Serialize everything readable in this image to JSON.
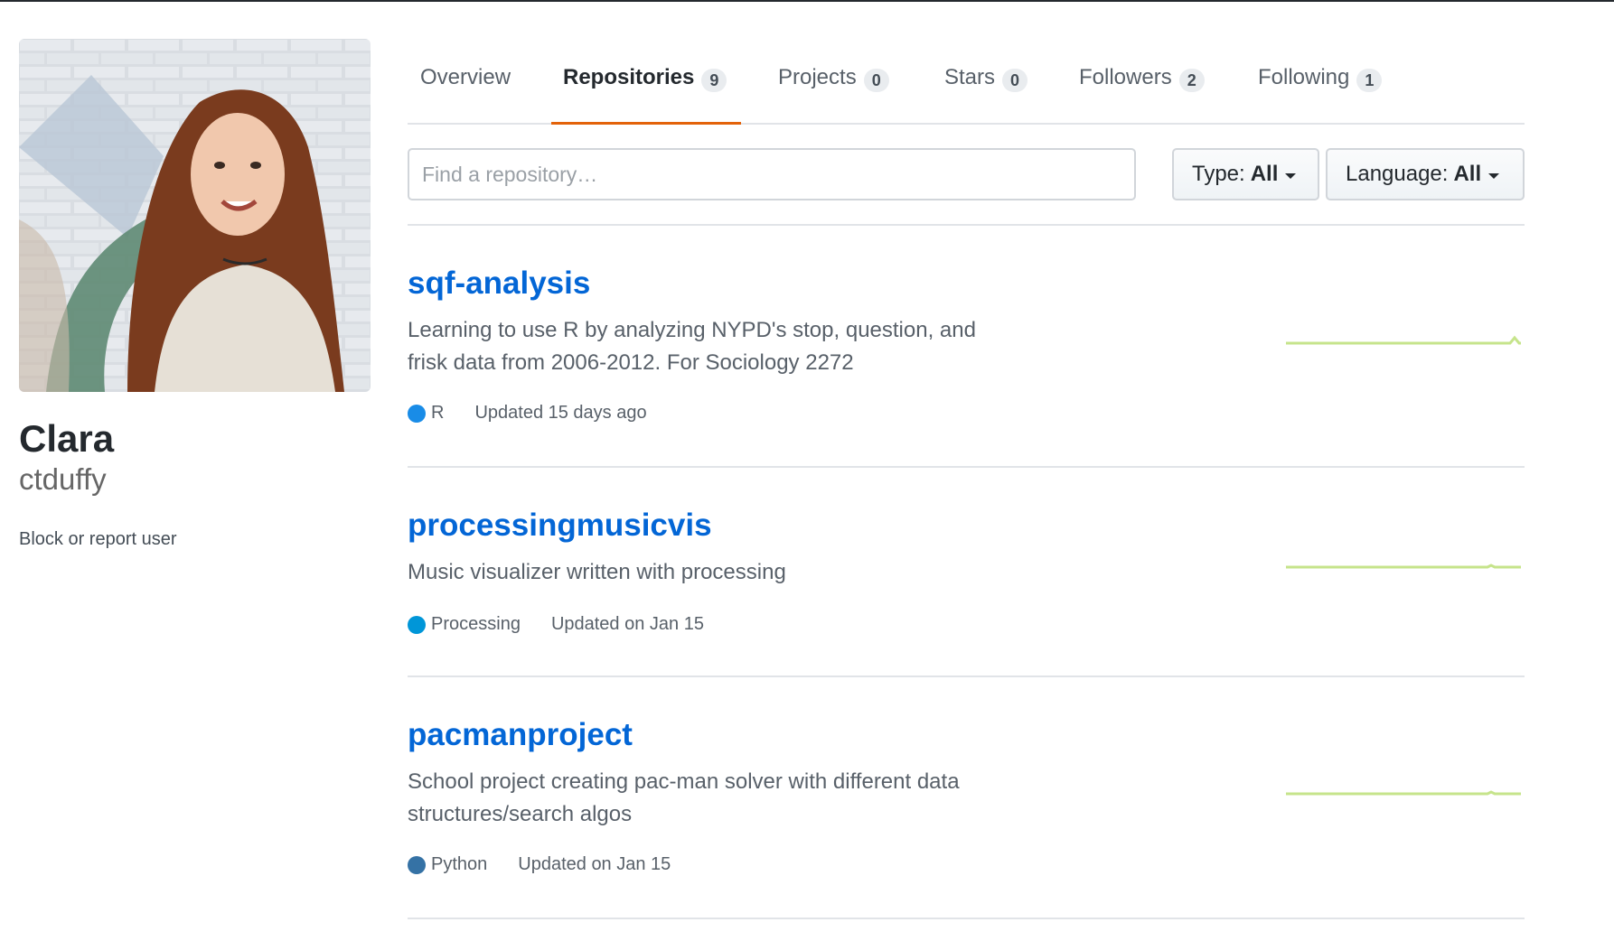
{
  "profile": {
    "name": "Clara",
    "username": "ctduffy",
    "block_link": "Block or report user"
  },
  "tabs": [
    {
      "label": "Overview",
      "count": null,
      "selected": false
    },
    {
      "label": "Repositories",
      "count": "9",
      "selected": true
    },
    {
      "label": "Projects",
      "count": "0",
      "selected": false
    },
    {
      "label": "Stars",
      "count": "0",
      "selected": false
    },
    {
      "label": "Followers",
      "count": "2",
      "selected": false
    },
    {
      "label": "Following",
      "count": "1",
      "selected": false
    }
  ],
  "filters": {
    "search_placeholder": "Find a repository…",
    "type_label": "Type:",
    "type_value": "All",
    "language_label": "Language:",
    "language_value": "All"
  },
  "repos": [
    {
      "name": "sqf-analysis",
      "description": "Learning to use R by analyzing NYPD's stop, question, and frisk data from 2006-2012. For Sociology 2272",
      "language": "R",
      "language_color": "#198ce7",
      "updated": "Updated 15 days ago"
    },
    {
      "name": "processingmusicvis",
      "description": "Music visualizer written with processing",
      "language": "Processing",
      "language_color": "#0096d8",
      "updated": "Updated on Jan 15"
    },
    {
      "name": "pacmanproject",
      "description": "School project creating pac-man solver with different data structures/search algos",
      "language": "Python",
      "language_color": "#3572A5",
      "updated": "Updated on Jan 15"
    }
  ],
  "colors": {
    "accent": "#0366d6",
    "selected_tab_underline": "#e36209",
    "sparkline": "#c6e48b"
  }
}
